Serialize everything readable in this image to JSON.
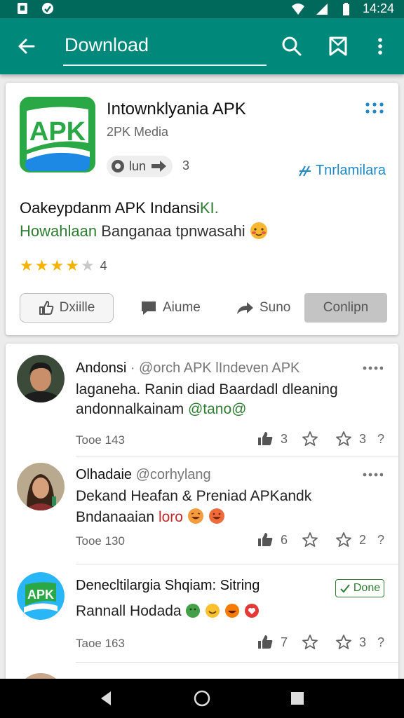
{
  "status_bar": {
    "time": "14:24"
  },
  "toolbar": {
    "search_text": "Download"
  },
  "app_card": {
    "app_icon_text": "APK",
    "title": "Intownklyania APK",
    "developer": "2PK Media",
    "pill_label": "lun",
    "pill_count": "3",
    "translate_label": "Tnrlamilara",
    "desc_line1_main": "Oakeypdanm APK Indansi",
    "desc_line1_tail": "KI.",
    "desc_line2_green": "Howahlaan",
    "desc_line2_rest": " Banganaa tpnwasahi",
    "rating_value": 4,
    "rating_count": "4",
    "actions": {
      "primary": "Dxiille",
      "comment": "Aiume",
      "share": "Suno",
      "filled": "Conlipn"
    },
    "colors": {
      "toolbar": "#00897b",
      "status": "#00695c",
      "star": "#f5b301"
    }
  },
  "posts": [
    {
      "author": "Andonsi",
      "handle": "· @orch APK lIndeven APK",
      "line1": "laganeha. Ranin diad Baardadl dleaning",
      "line2_main": "andonnalkainam ",
      "line2_green": "@tano@",
      "time": "Tooe 143",
      "likes": "3",
      "stars": "3"
    },
    {
      "author": "Olhadaie",
      "handle": " @corhylang",
      "line1": "Dekand Heafan & Preniad APKandk",
      "line2_main": "Bndanaaian ",
      "line2_red": "loro",
      "time": "Tooe 130",
      "likes": "6",
      "stars": "2"
    },
    {
      "author": "Denecltilargia Shqiam: Sitring",
      "badge": "Done",
      "line1": "Rannall Hodada",
      "time": "Taoe 163",
      "likes": "7",
      "stars": "3",
      "avatar_text": "APK"
    }
  ]
}
